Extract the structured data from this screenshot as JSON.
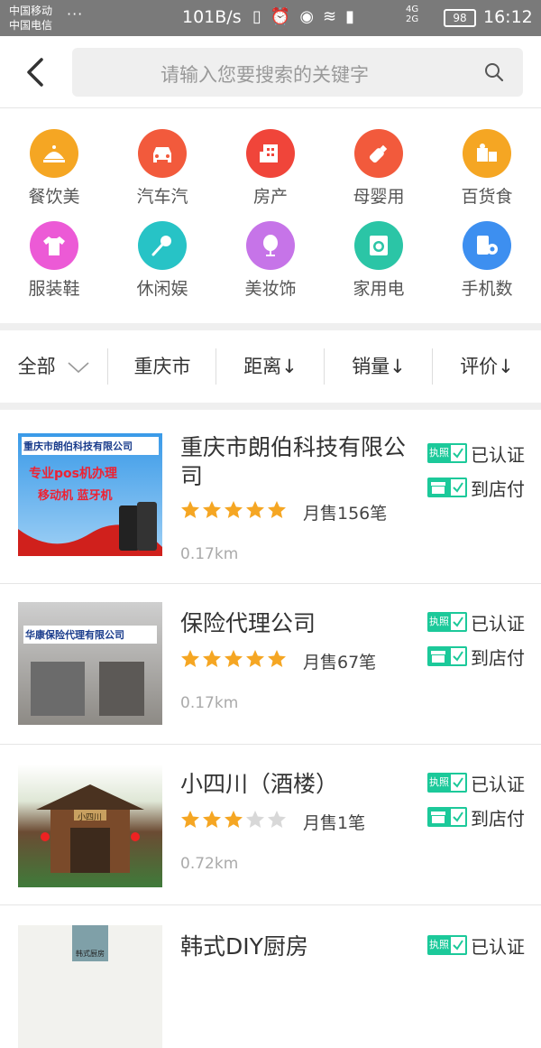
{
  "status_bar": {
    "carrier1": "中国移动",
    "carrier2": "中国电信",
    "speed": "101B/s",
    "network": "4G",
    "network2": "2G",
    "battery": "98",
    "time": "16:12"
  },
  "header": {
    "search_placeholder": "请输入您要搜索的关键字"
  },
  "categories": [
    {
      "label": "餐饮美",
      "color": "#f5a623",
      "icon": "cloche-icon"
    },
    {
      "label": "汽车汽",
      "color": "#f25a3c",
      "icon": "car-icon"
    },
    {
      "label": "房产",
      "color": "#f0453a",
      "icon": "building-icon"
    },
    {
      "label": "母婴用",
      "color": "#f25a3c",
      "icon": "bottle-icon"
    },
    {
      "label": "百货食",
      "color": "#f5a623",
      "icon": "goods-icon"
    },
    {
      "label": "服装鞋",
      "color": "#ec5ad6",
      "icon": "shirt-icon"
    },
    {
      "label": "休闲娱",
      "color": "#27c3c6",
      "icon": "microphone-icon"
    },
    {
      "label": "美妆饰",
      "color": "#c674e8",
      "icon": "mirror-icon"
    },
    {
      "label": "家用电",
      "color": "#2bc5a6",
      "icon": "washer-icon"
    },
    {
      "label": "手机数",
      "color": "#3d8ff0",
      "icon": "phone-gear-icon"
    }
  ],
  "filters": {
    "all": "全部",
    "city": "重庆市",
    "distance": "距离↓",
    "sales": "销量↓",
    "rating": "评价↓"
  },
  "badges": {
    "license_text": "执照",
    "certified": "已认证",
    "store_pay": "到店付"
  },
  "listings": [
    {
      "name": "重庆市朗伯科技有限公司",
      "rating": 5,
      "sales": "月售156笔",
      "distance": "0.17km",
      "thumb_title": "重庆市朗伯科技有限公司",
      "thumb_line1": "专业pos机办理",
      "thumb_line2": "移动机   蓝牙机"
    },
    {
      "name": "保险代理公司",
      "rating": 5,
      "sales": "月售67笔",
      "distance": "0.17km",
      "thumb_title": "华康保险代理有限公司"
    },
    {
      "name": "小四川（酒楼）",
      "rating": 3,
      "sales": "月售1笔",
      "distance": "0.72km",
      "thumb_title": "小四川"
    },
    {
      "name": "韩式DIY厨房",
      "thumb_title": "韩式厨房"
    }
  ],
  "colors": {
    "star_on": "#f5a623",
    "star_off": "#d8d8d8",
    "badge_green": "#1cc99a"
  }
}
